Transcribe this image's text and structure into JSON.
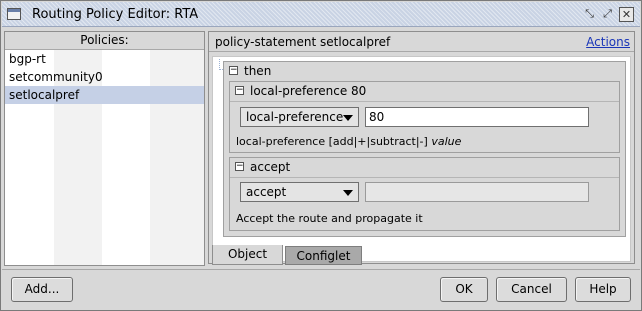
{
  "window": {
    "title": "Routing Policy Editor: RTA",
    "controls": {
      "minimize": "⤡",
      "restore": "⤢",
      "close": "✕"
    }
  },
  "policies": {
    "header": "Policies:",
    "items": [
      "bgp-rt",
      "setcommunity0",
      "setlocalpref"
    ],
    "selected": "setlocalpref"
  },
  "editor": {
    "title": "policy-statement setlocalpref",
    "actions_label": "Actions",
    "then": {
      "label": "then",
      "local_preference": {
        "label": "local-preference 80",
        "select_value": "local-preference",
        "input_value": "80",
        "hint_prefix": "local-preference [add|+|subtract|-] ",
        "hint_var": "value"
      },
      "accept": {
        "label": "accept",
        "select_value": "accept",
        "input_value": "",
        "description": "Accept the route and propagate it"
      }
    }
  },
  "tabs": [
    "Object",
    "Configlet"
  ],
  "active_tab": "Object",
  "buttons": {
    "add": "Add...",
    "ok": "OK",
    "cancel": "Cancel",
    "help": "Help"
  },
  "toggle_symbol": "−",
  "colors": {
    "selection": "#c5d0e6",
    "link": "#1a36b8",
    "inactive_tab": "#a9a9a9"
  }
}
